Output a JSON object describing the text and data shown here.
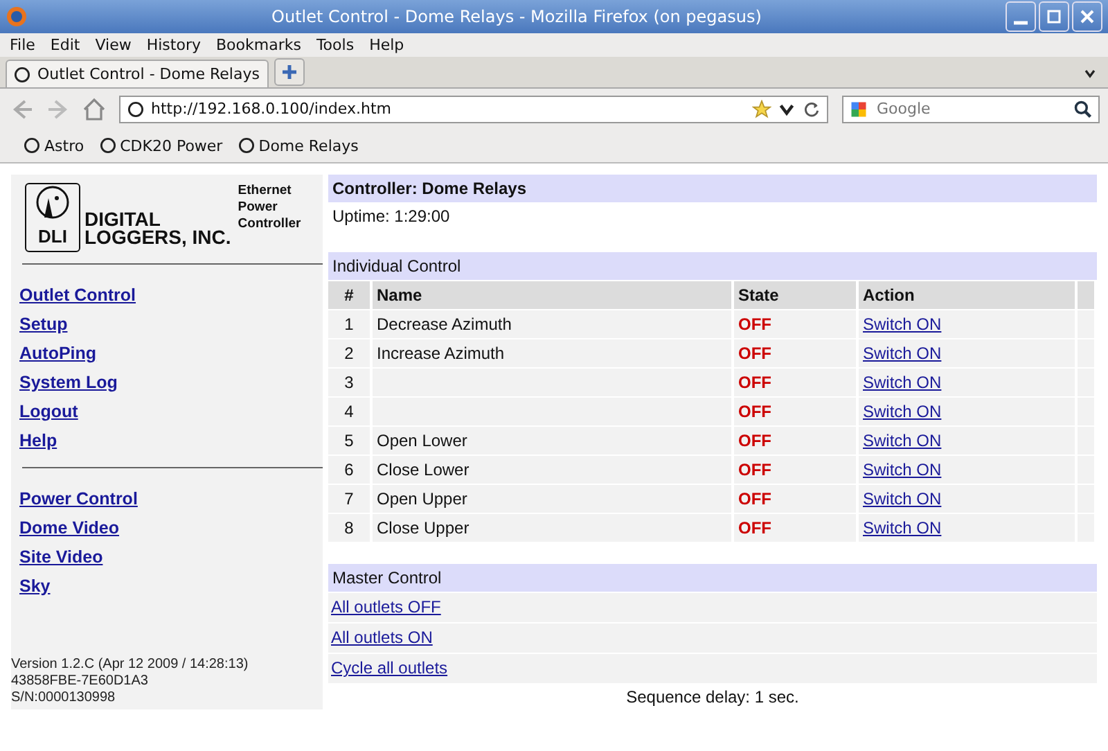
{
  "window": {
    "title": "Outlet Control - Dome Relays - Mozilla Firefox (on pegasus)"
  },
  "menu": [
    "File",
    "Edit",
    "View",
    "History",
    "Bookmarks",
    "Tools",
    "Help"
  ],
  "tabs": [
    {
      "label": "Outlet Control - Dome Relays",
      "selected": true
    }
  ],
  "address": {
    "value": "http://192.168.0.100/index.htm"
  },
  "search": {
    "placeholder": "Google"
  },
  "bookmarks": [
    "Astro",
    "CDK20 Power",
    "Dome Relays"
  ],
  "sidebar": {
    "logo": {
      "mark": "DLI",
      "name_1": "DIGITAL",
      "name_2": "LOGGERS, INC.",
      "product": [
        "Ethernet",
        "Power",
        "Controller"
      ]
    },
    "links": [
      "Outlet Control",
      "Setup",
      "AutoPing",
      "System Log",
      "Logout",
      "Help"
    ],
    "links_2": [
      "Power Control",
      "Dome Video",
      "Site Video",
      "Sky"
    ],
    "version": [
      "Version 1.2.C (Apr 12 2009 / 14:28:13)",
      "43858FBE-7E60D1A3",
      "S/N:0000130998"
    ]
  },
  "controller": {
    "title": "Controller: Dome Relays",
    "uptime": "Uptime: 1:29:00"
  },
  "individual": {
    "title": "Individual Control",
    "columns": [
      "#",
      "Name",
      "State",
      "Action"
    ],
    "rows": [
      {
        "num": "1",
        "name": "Decrease Azimuth",
        "state": "OFF",
        "action": "Switch ON"
      },
      {
        "num": "2",
        "name": "Increase Azimuth",
        "state": "OFF",
        "action": "Switch ON"
      },
      {
        "num": "3",
        "state": "OFF",
        "action": "Switch ON"
      },
      {
        "num": "4",
        "state": "OFF",
        "action": "Switch ON"
      },
      {
        "num": "5",
        "name": "Open Lower",
        "state": "OFF",
        "action": "Switch ON"
      },
      {
        "num": "6",
        "name": "Close Lower",
        "state": "OFF",
        "action": "Switch ON"
      },
      {
        "num": "7",
        "name": "Open Upper",
        "state": "OFF",
        "action": "Switch ON"
      },
      {
        "num": "8",
        "name": "Close Upper",
        "state": "OFF",
        "action": "Switch ON"
      }
    ]
  },
  "master": {
    "title": "Master Control",
    "links": [
      "All outlets OFF",
      "All outlets ON",
      "Cycle all outlets"
    ],
    "delay": "Sequence delay: 1 sec."
  }
}
